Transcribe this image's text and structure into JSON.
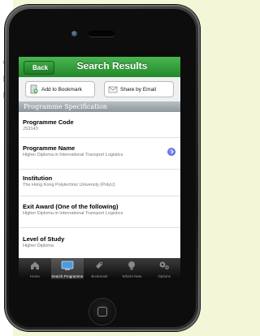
{
  "nav": {
    "back_label": "Back",
    "title": "Search Results"
  },
  "toolbar": {
    "bookmark_label": "Add to Bookmark",
    "email_label": "Share by Email"
  },
  "section": {
    "title": "Programme Specification"
  },
  "fields": [
    {
      "label": "Programme Code",
      "value": "JS3143"
    },
    {
      "label": "Programme Name",
      "value": "Higher Diploma in International Transport Logistics"
    },
    {
      "label": "Institution",
      "value": "The Hong Kong Polytechnic University (PolyU)"
    },
    {
      "label": "Exit Award (One of the following)",
      "value": "Higher Diploma in International Transport Logistics"
    },
    {
      "label": "Level of Study",
      "value": "Higher Diploma"
    }
  ],
  "tabs": [
    {
      "label": "Home",
      "icon": "home-icon",
      "active": false
    },
    {
      "label": "Search Programme",
      "icon": "search-programme-icon",
      "active": true
    },
    {
      "label": "Bookmark",
      "icon": "bookmark-icon",
      "active": false
    },
    {
      "label": "What's New",
      "icon": "lightbulb-icon",
      "active": false
    },
    {
      "label": "Options",
      "icon": "gears-icon",
      "active": false
    }
  ],
  "colors": {
    "nav_green": "#2e9b35",
    "section_grey": "#9aa2a8",
    "disclosure_blue": "#4a5fd6"
  }
}
